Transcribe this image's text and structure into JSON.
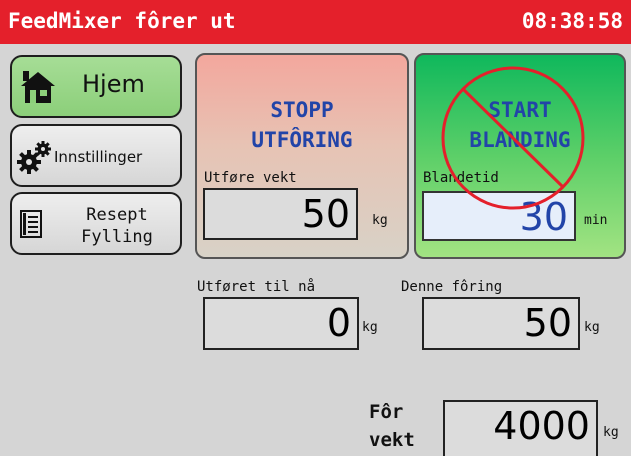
{
  "titlebar": {
    "title": "FeedMixer fôrer ut",
    "clock": "08:38:58"
  },
  "nav": {
    "home": {
      "label": "Hjem",
      "icon": "house-icon"
    },
    "settings": {
      "label": "Innstillinger",
      "icon": "gears-icon"
    },
    "recipe": {
      "line1": "Resept",
      "line2": "Fylling",
      "icon": "document-icon"
    }
  },
  "stop_panel": {
    "line1": "STOPP",
    "line2": "UTFÔRING",
    "field_label": "Utføre vekt",
    "value": "50",
    "unit": "kg"
  },
  "start_panel": {
    "line1": "START",
    "line2": "BLANDING",
    "field_label": "Blandetid",
    "value": "30",
    "unit": "min",
    "disabled_overlay": "prohibited-icon"
  },
  "fed_so_far": {
    "label": "Utføret til nå",
    "value": "0",
    "unit": "kg"
  },
  "this_feeding": {
    "label": "Denne fôring",
    "value": "50",
    "unit": "kg"
  },
  "feed_weight": {
    "label_line1": "Fôr",
    "label_line2": "vekt",
    "value": "4000",
    "unit": "kg"
  },
  "colors": {
    "titlebar": "#e4202b",
    "home_button": "#8ccf7a",
    "stop_panel": "#f3a79d",
    "start_panel": "#0fb85c",
    "panel_text": "#2244a8",
    "prohibit": "#e4202b"
  }
}
